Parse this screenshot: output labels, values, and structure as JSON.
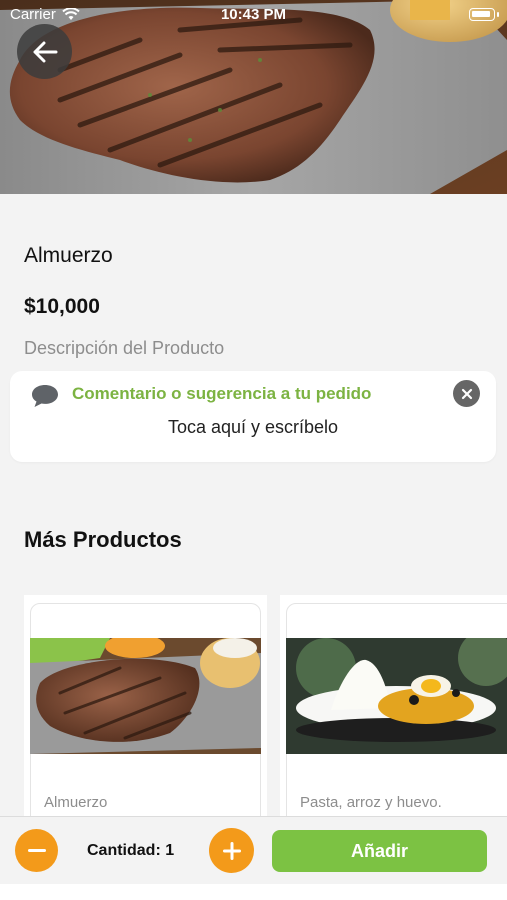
{
  "status_bar": {
    "carrier": "Carrier",
    "time": "10:43 PM"
  },
  "product": {
    "name": "Almuerzo",
    "price": "$10,000",
    "description": "Descripción del Producto"
  },
  "comment": {
    "title": "Comentario o sugerencia a tu pedido",
    "hint": "Toca aquí y escríbelo",
    "icon": "speech-bubble-icon"
  },
  "more_products": {
    "title": "Más Productos",
    "items": [
      {
        "label": "Almuerzo"
      },
      {
        "label": "Pasta, arroz y huevo."
      }
    ]
  },
  "bottom_bar": {
    "quantity_text": "Cantidad: 1",
    "add_label": "Añadir"
  },
  "colors": {
    "accent_green": "#7cc243",
    "comment_green": "#7cb342",
    "orange": "#f39a1a",
    "background": "#f3f3f3"
  }
}
